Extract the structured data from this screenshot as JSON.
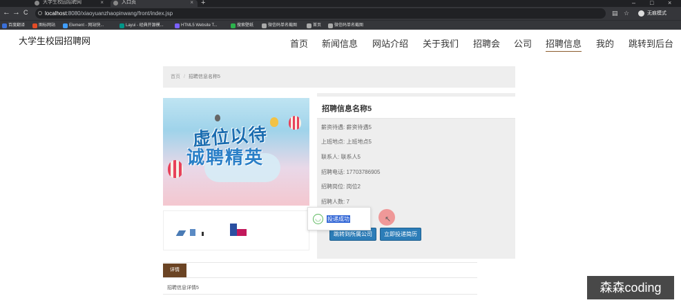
{
  "browser": {
    "tabs": [
      {
        "title": "大学生校园招聘网",
        "active": false
      },
      {
        "title": "入口页",
        "active": true
      }
    ],
    "new_tab": "+",
    "window_controls": [
      "–",
      "□",
      "×"
    ],
    "nav_icons": [
      "←",
      "→",
      "C"
    ],
    "url_host": "localhost",
    "url_rest": ":8080/xiaoyuanzhaopinwang/front/index.jsp",
    "addr_icons": [
      "☆"
    ],
    "incognito_label": "无痕模式",
    "bookmarks": [
      {
        "label": "百度翻译",
        "color": "#3a6fd8"
      },
      {
        "label": "图标网站",
        "color": "#e34c26"
      },
      {
        "label": "Element - 网站快...",
        "color": "#409eff"
      },
      {
        "label": "Layui - 经典开源模...",
        "color": "#009688"
      },
      {
        "label": "HTML5 Website T...",
        "color": "#7b61ff"
      },
      {
        "label": "搜索壁纸",
        "color": "#2bb24c"
      },
      {
        "label": "微信码单名截图",
        "color": "#aaaaaa"
      },
      {
        "label": "首页",
        "color": "#aaaaaa"
      },
      {
        "label": "微信码单名截图",
        "color": "#aaaaaa"
      }
    ]
  },
  "site": {
    "brand": "大学生校园招聘网",
    "nav": [
      "首页",
      "新闻信息",
      "网站介绍",
      "关于我们",
      "招聘会",
      "公司",
      "招聘信息",
      "我的",
      "跳转到后台"
    ],
    "active_nav": "招聘信息"
  },
  "breadcrumb": {
    "home": "首页",
    "separator": "/",
    "current": "招聘信息名称5"
  },
  "banner": {
    "line1": "虚位以待",
    "line2": "诚聘精英"
  },
  "info": {
    "title": "招聘信息名称5",
    "rows": [
      {
        "label": "薪资待遇:",
        "value": "薪资待遇5"
      },
      {
        "label": "上班地点:",
        "value": "上班地点5"
      },
      {
        "label": "联系人:",
        "value": "联系人5"
      },
      {
        "label": "招聘电话:",
        "value": "17703786905"
      },
      {
        "label": "招聘岗位:",
        "value": "岗位2"
      },
      {
        "label": "招聘人数:",
        "value": "7"
      }
    ],
    "buttons": [
      "跳转到所属公司",
      "立即投递简历"
    ]
  },
  "toast": {
    "message": "投递成功"
  },
  "detail": {
    "tab": "详情",
    "text": "招聘信息详情5"
  },
  "watermark": "森森coding"
}
